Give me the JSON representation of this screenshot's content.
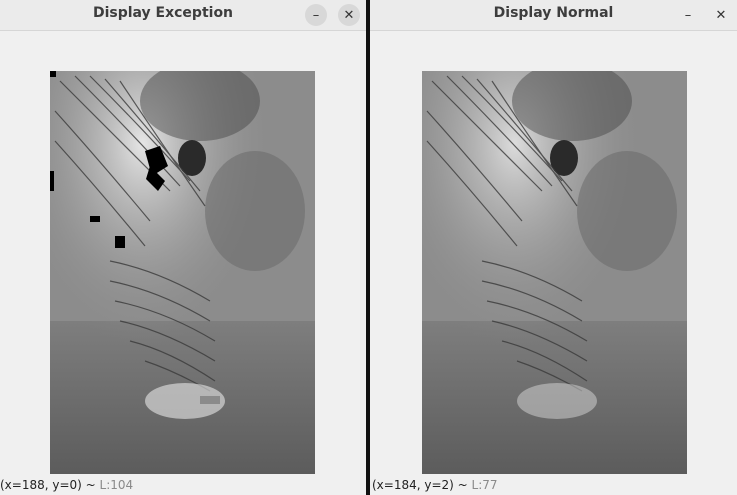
{
  "windows": [
    {
      "title": "Display Exception",
      "status": {
        "coords": "(x=188, y=0) ~ ",
        "lvalue": "L:104"
      }
    },
    {
      "title": "Display Normal",
      "status": {
        "coords": "(x=184, y=2) ~ ",
        "lvalue": "L:77"
      }
    }
  ],
  "icons": {
    "minimize": "minimize-icon",
    "close": "close-icon"
  },
  "glyphs": {
    "minimize": "–",
    "close": "✕"
  }
}
